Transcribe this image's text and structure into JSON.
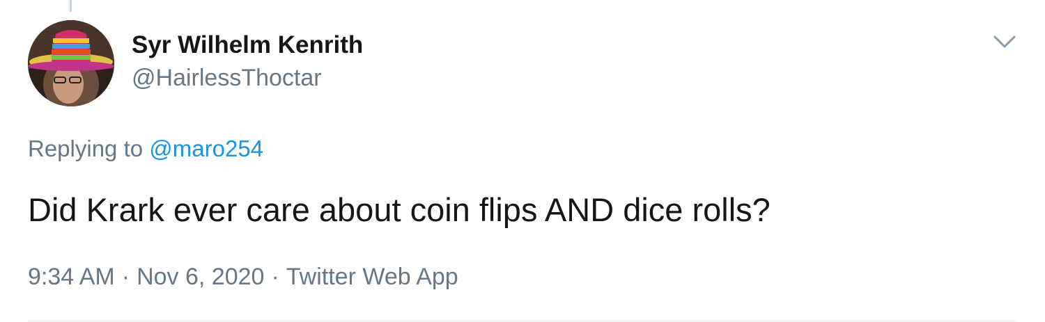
{
  "tweet": {
    "display_name": "Syr Wilhelm Kenrith",
    "handle": "@HairlessThoctar",
    "replying_prefix": "Replying to",
    "replying_to": "@maro254",
    "text": "Did Krark ever care about coin flips AND dice rolls?",
    "time": "9:34 AM",
    "separator": "·",
    "date": "Nov 6, 2020",
    "source": "Twitter Web App"
  },
  "icons": {
    "more": "chevron-down-icon",
    "avatar": "avatar"
  },
  "colors": {
    "text_primary": "#14171a",
    "text_secondary": "#657786",
    "link": "#1b95e0",
    "border": "#e6ecf0"
  }
}
